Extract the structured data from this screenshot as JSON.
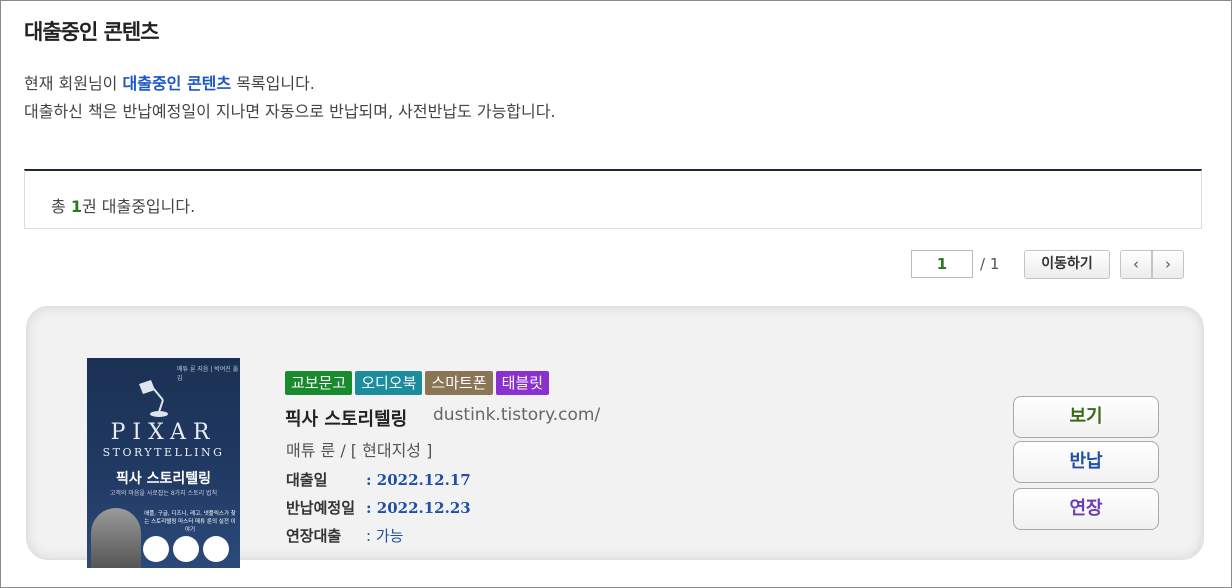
{
  "page": {
    "title": "대출중인 콘텐츠"
  },
  "intro": {
    "line1_pre": "현재 회원님이 ",
    "line1_highlight": "대출중인 콘텐츠",
    "line1_post": " 목록입니다.",
    "line2": "대출하신 책은 반납예정일이 지나면 자동으로 반납되며, 사전반납도 가능합니다."
  },
  "summary": {
    "pre": "총 ",
    "count": "1",
    "post": "권 대출중입니다."
  },
  "pager": {
    "current": "1",
    "total": "/ 1",
    "go_label": "이동하기",
    "prev": "‹",
    "next": "›"
  },
  "book": {
    "badges": [
      "교보문고",
      "오디오북",
      "스마트폰",
      "태블릿"
    ],
    "title": "픽사 스토리텔링",
    "url": "dustink.tistory.com/",
    "author_publisher": "매튜 룬 / [ 현대지성 ]",
    "loan_label": "대출일",
    "loan_date": ": 2022.12.17",
    "due_label": "반납예정일",
    "due_date": ": 2022.12.23",
    "extend_label": "연장대출",
    "extend_value": ": 가능",
    "cover": {
      "pixar": "PIXAR",
      "storytelling": "STORYTELLING",
      "kr_title": "픽사 스토리텔링",
      "subtitle": "고객의 마음을 사로잡는 8가지 스토리 법칙",
      "top": "매튜 룬 지음 | 박여진 옮김",
      "blurb": "애플, 구글, 디즈니, 레고, 넷플릭스가 찾는 스토리텔링 마스터 매튜 룬의 실전 이야기"
    }
  },
  "actions": {
    "view": "보기",
    "return": "반납",
    "extend": "연장"
  }
}
